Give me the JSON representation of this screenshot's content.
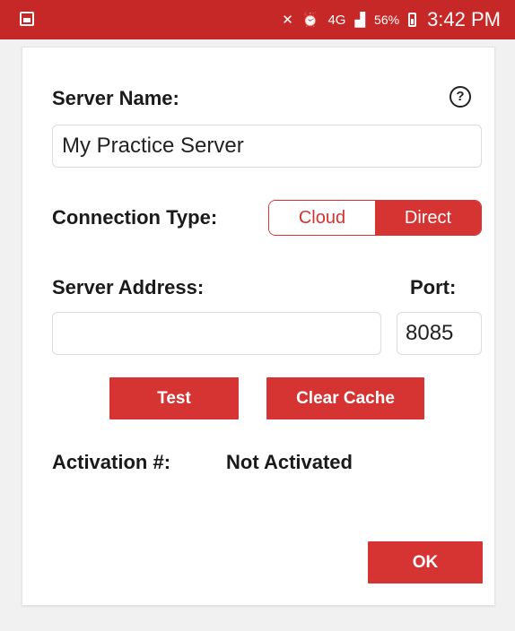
{
  "status_bar": {
    "time": "3:42 PM",
    "battery_percent": "56%",
    "network": "4G",
    "icons": [
      "gallery-icon",
      "mute-icon",
      "alarm-icon",
      "network-4g-icon",
      "signal-icon",
      "battery-charging-icon"
    ]
  },
  "dialog": {
    "server_name_label": "Server Name:",
    "server_name_value": "My Practice Server",
    "help_glyph": "?",
    "connection_type_label": "Connection Type:",
    "connection_options": [
      "Cloud",
      "Direct"
    ],
    "connection_selected": "Direct",
    "server_address_label": "Server Address:",
    "server_address_value": "",
    "port_label": "Port:",
    "port_value": "8085",
    "test_button": "Test",
    "clear_cache_button": "Clear Cache",
    "activation_label": "Activation #:",
    "activation_value": "Not Activated",
    "ok_button": "OK"
  },
  "colors": {
    "accent": "#d63333",
    "status_bar": "#c62828",
    "text": "#1a1a1a"
  }
}
